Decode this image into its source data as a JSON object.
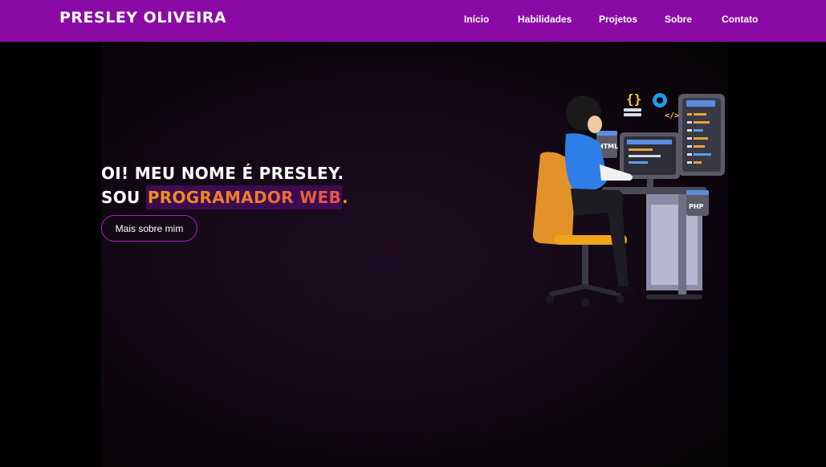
{
  "header": {
    "brand": "PRESLEY OLIVEIRA",
    "nav": [
      "Início",
      "Habilidades",
      "Projetos",
      "Sobre",
      "Contato"
    ]
  },
  "hero": {
    "line1": "OI! MEU NOME É PRESLEY.",
    "line2_prefix": "SOU ",
    "line2_highlight": "PROGRAMADOR WEB",
    "line2_suffix": ".",
    "cta_label": "Mais sobre mim"
  },
  "illustration": {
    "tags": [
      "HTML",
      "PHP",
      "{}",
      "</>"
    ],
    "icon": "developer-at-desk-illustration"
  },
  "colors": {
    "header_bg": "#8b0aa5",
    "accent_orange": "#f2921e",
    "highlight_bg": "#3d0c50",
    "button_border": "#b21bd0"
  }
}
